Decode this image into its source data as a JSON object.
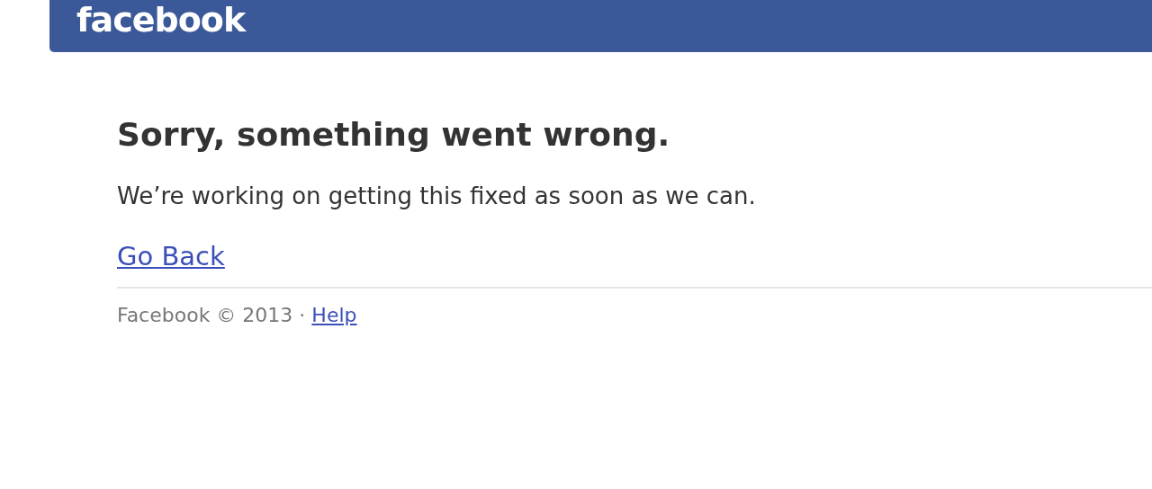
{
  "header": {
    "logo": "facebook"
  },
  "error": {
    "title": "Sorry, something went wrong.",
    "message": "We’re working on getting this fixed as soon as we can.",
    "link": "Go Back"
  },
  "footer": {
    "text": "Facebook © 2013 ·",
    "link": "Help"
  }
}
